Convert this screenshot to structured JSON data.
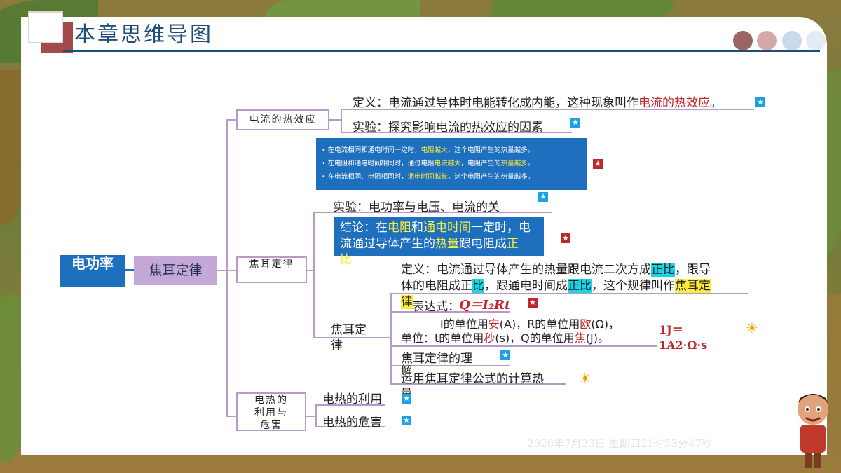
{
  "title": "本章思维导图",
  "clock": "2026年7月23日 星期四21时53分47秒",
  "root": "电功率",
  "level1": "焦耳定律",
  "branch_heat_effect": {
    "label": "电流的热效应",
    "definition_prefix": "定义：电流通过导体时电能转化成内能，这种现象叫作",
    "definition_term": "电流的热效应",
    "definition_end": "。",
    "experiment": "实验：探究影响电流的热效应的因素",
    "bullets": [
      {
        "pre": "• 在电流相同和通电时间一定时，",
        "hl": "电阻越大",
        "post": "，这个电阻产生的热量越多。"
      },
      {
        "pre": "• 在电阻和通电时间相同时，通过电阻",
        "hl": "电流越大",
        "post": "，电阻产生的",
        "hl2": "热量越多",
        "post2": "。"
      },
      {
        "pre": "• 在电流相同、电阻相同时，",
        "hl": "通电时间越长",
        "post": "，这个电阻产生的热量越多。"
      }
    ]
  },
  "branch_joule": {
    "label": "焦耳定律",
    "experiment": "实验：电功率与电压、电流的关",
    "conclusion": {
      "p1": "结论：在",
      "h1": "电阻",
      "p2": "和",
      "h2": "通电时间",
      "p3": "一定时，电",
      "p4": "流通过导体产生的",
      "h3": "热量",
      "p5": "跟电阻成",
      "h4": "正比",
      "p6": "。"
    },
    "sub_label": "焦耳定律",
    "definition": {
      "p1": "定义：电流通过导体产生的热量跟电流二次方成",
      "h1": "正比",
      "p2": "，跟导",
      "p3": "体的电阻成正",
      "h2": "比",
      "p4": "，跟通电时间成",
      "h3": "正比",
      "p5": "，这个规律叫作",
      "h4": "焦耳定",
      "h5": "律"
    },
    "expression_label": "表达式：",
    "expression_formula": "Q＝I₂Rt",
    "units_line1_a": "I的单位用",
    "units_line1_b": "安",
    "units_line1_c": "(A)，",
    "units_line1_d": "R的单位用",
    "units_line1_e": "欧",
    "units_line1_f": "(Ω)，",
    "units_label": "单位：",
    "units_line2_a": "t的单位用",
    "units_line2_b": "秒",
    "units_line2_c": "(s)，",
    "units_line2_d": "Q的单位用",
    "units_line2_e": "焦",
    "units_line2_f": "(J)。",
    "unit_eq1": "1J＝",
    "unit_eq2": "1A2·Ω·s",
    "understanding": "焦耳定律的理",
    "understanding2": "解",
    "application": "运用焦耳定律公式的计算热",
    "application2": "量"
  },
  "branch_use": {
    "label_lines": [
      "电热的",
      "利用与",
      "危害"
    ],
    "use": "电热的利用",
    "harm": "电热的危害"
  },
  "colors": {
    "accent_blue": "#1f6fbf",
    "highlight_yellow": "#ffee3a",
    "highlight_cyan": "#19d6e6",
    "red": "#c0272d",
    "branch": "#b79ac7"
  },
  "icons": [
    "star-icon",
    "sun-icon"
  ]
}
